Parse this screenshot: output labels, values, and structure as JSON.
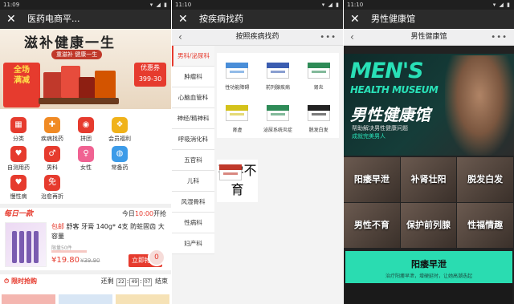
{
  "screen1": {
    "status": {
      "time": "11:09",
      "icons": "▾ ◢ ▮"
    },
    "title": "医药电商平...",
    "banner": {
      "headline": "滋补健康一生",
      "subline": "重滋补  健康一生",
      "badge_line1": "全场",
      "badge_line2": "满减",
      "promo_line1": "优惠券",
      "promo_line2": "399-30"
    },
    "grid": [
      {
        "label": "分类",
        "icon": "category-icon",
        "color": "#e63b2e",
        "glyph": "▦"
      },
      {
        "label": "疾病找药",
        "icon": "medicine-box-icon",
        "color": "#f08a24",
        "glyph": "✚"
      },
      {
        "label": "拼团",
        "icon": "group-buy-icon",
        "color": "#e63b2e",
        "glyph": "◉"
      },
      {
        "label": "会员福利",
        "icon": "gift-icon",
        "color": "#f0b21a",
        "glyph": "❖"
      },
      {
        "label": "自测用药",
        "icon": "test-icon",
        "color": "#e63b2e",
        "glyph": "♥"
      },
      {
        "label": "男科",
        "icon": "male-icon",
        "color": "#e63b2e",
        "glyph": "♂"
      },
      {
        "label": "女性",
        "icon": "female-icon",
        "color": "#f06292",
        "glyph": "♀"
      },
      {
        "label": "常备药",
        "icon": "pill-icon",
        "color": "#3c9be8",
        "glyph": "◍"
      },
      {
        "label": "慢性病",
        "icon": "heart-icon",
        "color": "#e63b2e",
        "glyph": "♥"
      },
      {
        "label": "治愈再折",
        "icon": "discount-icon",
        "color": "#e63b2e",
        "glyph": "免"
      }
    ],
    "daily": {
      "logo": "每日一款",
      "time_prefix": "今日",
      "time_value": "10:00",
      "time_suffix": "开抢"
    },
    "product": {
      "tag": "包邮",
      "name": " 舒客 牙膏 140g* 4支 防蛀固齿 大容量",
      "limit": "限量50件",
      "price": "¥19.80",
      "old_price": "¥39.90",
      "buy": "立即抢",
      "cart_count": "0"
    },
    "flash": {
      "title": "限时抢购",
      "prefix": "还剩",
      "h": "22",
      "m": "49",
      "s": "07",
      "suffix": "结束"
    }
  },
  "screen2": {
    "status": {
      "time": "11:10",
      "icons": "▾ ◢ ▮"
    },
    "title": "按疾病找药",
    "nav_title": "按照疾病找药",
    "more": "•••",
    "categories": [
      "男科/泌尿科",
      "肿瘤科",
      "心脑血管科",
      "神经/精神科",
      "呼吸消化科",
      "五官科",
      "儿科",
      "风湿骨科",
      "性病科",
      "妇产科"
    ],
    "items": [
      {
        "label": "性功能障碍",
        "color": "#4a8ed8"
      },
      {
        "label": "前列腺疾病",
        "color": "#3b5db0"
      },
      {
        "label": "肾炎",
        "color": "#2e8b57"
      },
      {
        "label": "肾虚",
        "color": "#d4c21a"
      },
      {
        "label": "泌尿系统炎症",
        "color": "#2e8b57"
      },
      {
        "label": "脱发白发",
        "color": "#222222"
      }
    ],
    "extra": {
      "label": "不孕不育",
      "color": "#c0392b"
    }
  },
  "screen3": {
    "status": {
      "time": "11:10",
      "icons": "▾ ◢ ▮"
    },
    "title": "男性健康馆",
    "nav_title": "男性健康馆",
    "more": "•••",
    "banner": {
      "men": "MEN'S",
      "museum": "HEALTH MUSEUM",
      "cn": "男性健康馆",
      "desc1": "帮助解决男性健康问题",
      "desc2": "成就完美男人"
    },
    "tiles": [
      "阳痿早泄",
      "补肾壮阳",
      "脱发白发",
      "男性不育",
      "保护前列腺",
      "性福情趣"
    ],
    "section": {
      "title": "阳痿早泄",
      "subtitle": "治疗阳痿早泄，增硬延时，让她高潮迭起"
    }
  }
}
